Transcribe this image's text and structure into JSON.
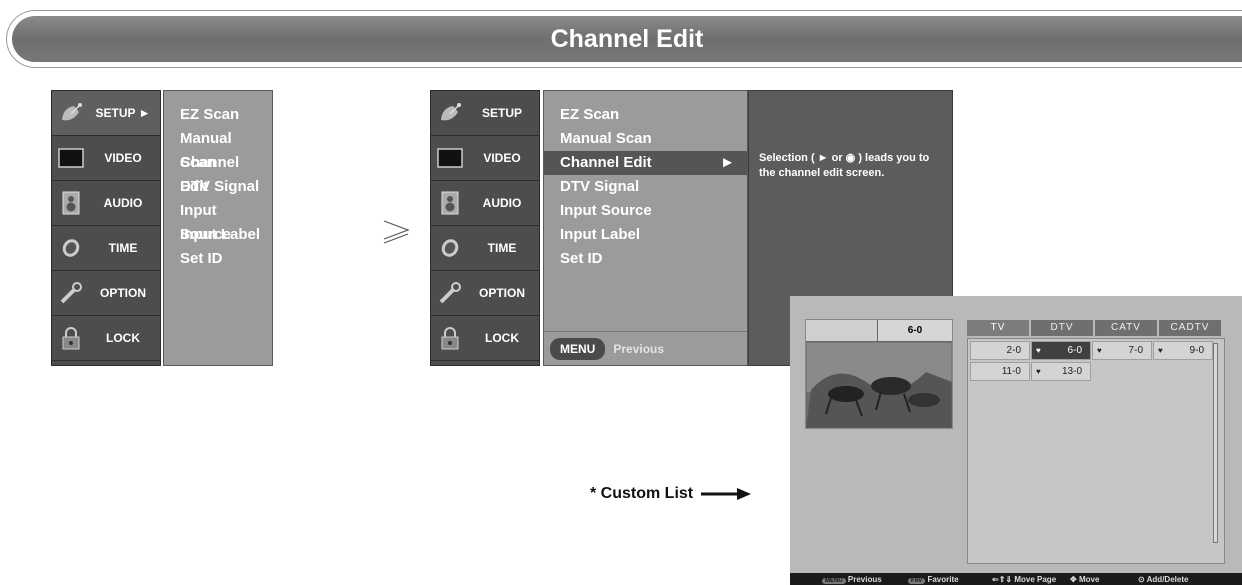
{
  "header": {
    "title": "Channel Edit"
  },
  "left_menu": {
    "side_items": [
      {
        "label": "SETUP ►",
        "icon": "satellite-dish-icon",
        "active": true
      },
      {
        "label": "VIDEO",
        "icon": "monitor-icon"
      },
      {
        "label": "AUDIO",
        "icon": "speaker-icon"
      },
      {
        "label": "TIME",
        "icon": "clock-icon"
      },
      {
        "label": "OPTION",
        "icon": "wrench-icon"
      },
      {
        "label": "LOCK",
        "icon": "padlock-icon"
      }
    ],
    "sub_items": [
      "EZ Scan",
      "Manual Scan",
      "Channel Edit",
      "DTV Signal",
      "Input Source",
      "Input Label",
      "Set ID"
    ]
  },
  "arrow_symbol": "≥",
  "right_menu": {
    "side_items": [
      {
        "label": "SETUP",
        "icon": "satellite-dish-icon"
      },
      {
        "label": "VIDEO",
        "icon": "monitor-icon"
      },
      {
        "label": "AUDIO",
        "icon": "speaker-icon"
      },
      {
        "label": "TIME",
        "icon": "clock-icon"
      },
      {
        "label": "OPTION",
        "icon": "wrench-icon"
      },
      {
        "label": "LOCK",
        "icon": "padlock-icon"
      }
    ],
    "sub_items": [
      "EZ Scan",
      "Manual Scan",
      "Channel Edit",
      "DTV Signal",
      "Input Source",
      "Input Label",
      "Set ID"
    ],
    "highlighted_item": "Channel Edit",
    "highlighted_arrow": "►",
    "footer_button": "MENU",
    "footer_label": "Previous",
    "info_text": "Selection ( ► or ◉ ) leads you to the channel edit screen."
  },
  "custom_list": {
    "label": "* Custom List"
  },
  "channel_screen": {
    "preview_channel": "6-0",
    "tabs": [
      "TV",
      "DTV",
      "CATV",
      "CADTV"
    ],
    "active_tab": "TV",
    "channels": [
      {
        "num": "2-0",
        "fav": false,
        "selected": false
      },
      {
        "num": "6-0",
        "fav": true,
        "selected": true
      },
      {
        "num": "7-0",
        "fav": true,
        "selected": false
      },
      {
        "num": "9-0",
        "fav": true,
        "selected": false
      },
      {
        "num": "11-0",
        "fav": false,
        "selected": false
      },
      {
        "num": "13-0",
        "fav": true,
        "selected": false
      }
    ],
    "fav_symbol": "♥",
    "footer": [
      "Previous",
      "Favorite",
      "Move Page",
      "Move",
      "Add/Delete"
    ],
    "footer_badges": [
      "MENU",
      "FAV"
    ],
    "footer_glyphs": [
      "⇐⇑⇓",
      "✥",
      "⊙"
    ]
  }
}
